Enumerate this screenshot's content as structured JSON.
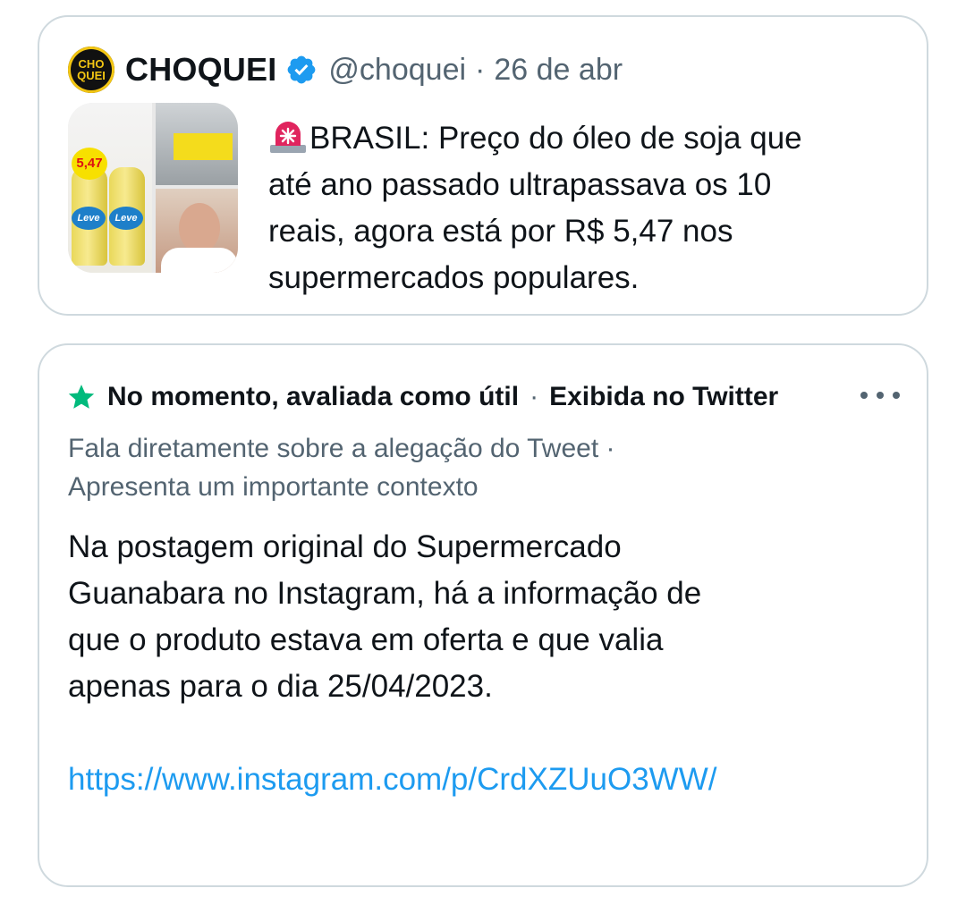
{
  "quoted_tweet": {
    "avatar_text_top": "CHO",
    "avatar_text_bottom": "QUEI",
    "author_name": "CHOQUEI",
    "verified_icon": "verified-badge-icon",
    "handle": "@choquei",
    "separator": "·",
    "date": "26 de abr",
    "media_thumbnail": {
      "price_label": "5,47",
      "bottle_brand": "Leve"
    },
    "text_emoji": "rotating-light-icon",
    "text_line1": "BRASIL: Preço do óleo de soja que",
    "text_line2": "até ano passado ultrapassava os 10",
    "text_line3": "reais, agora está por R$ 5,47 nos",
    "text_line4": "supermercados populares."
  },
  "community_note": {
    "status_icon": "star-icon",
    "status_color": "#00ba7c",
    "rating": "No momento, avaliada como útil",
    "separator": "·",
    "shown_on": "Exibida no Twitter",
    "more_icon": "more-options-icon",
    "reason_line1": "Fala diretamente sobre a alegação do Tweet ·",
    "reason_line2": "Apresenta um importante contexto",
    "body_line1": "Na postagem original do Supermercado",
    "body_line2": "Guanabara no Instagram, há a informação de",
    "body_line3": "que o produto estava em oferta e que valia",
    "body_line4": "apenas para o dia 25/04/2023.",
    "link": "https://www.instagram.com/p/CrdXZUuO3WW/",
    "link_color": "#1d9bf0"
  }
}
